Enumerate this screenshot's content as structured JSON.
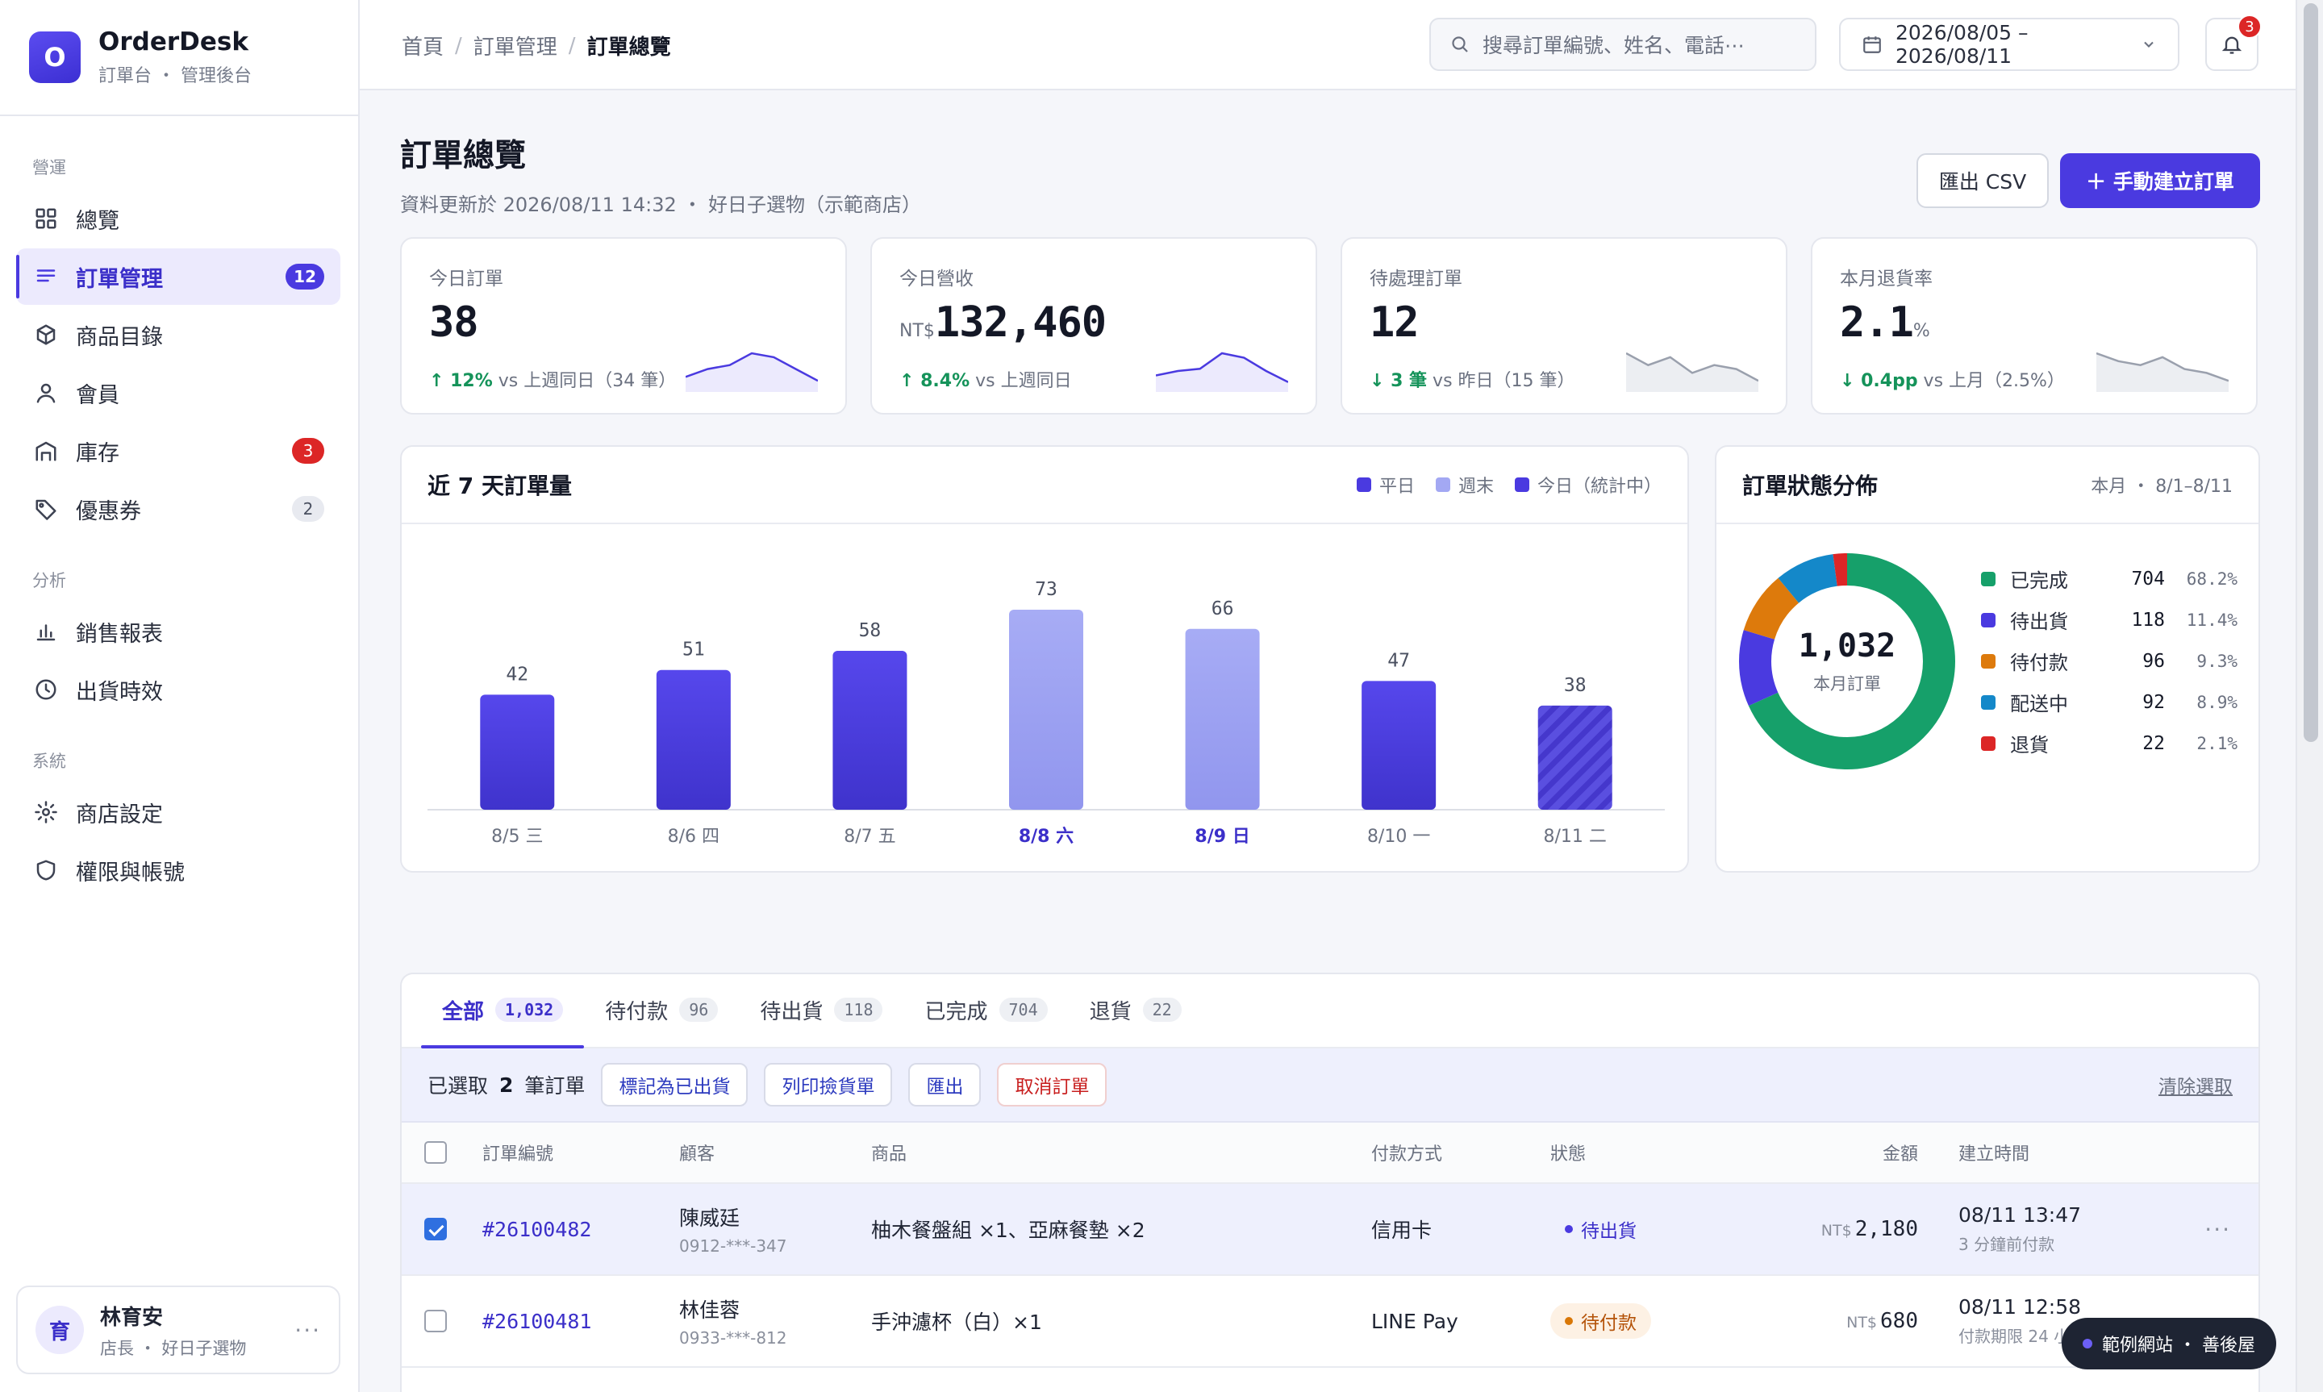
{
  "brand": {
    "name": "OrderDesk",
    "logo_letter": "O",
    "subtitle": "訂單台 ・ 管理後台"
  },
  "sidebar": {
    "sections": [
      {
        "label": "營運",
        "items": [
          {
            "label": "總覽",
            "icon": "grid-icon"
          },
          {
            "label": "訂單管理",
            "icon": "list-icon",
            "badge": "12",
            "active": true
          },
          {
            "label": "商品目錄",
            "icon": "box-icon"
          },
          {
            "label": "會員",
            "icon": "user-icon"
          },
          {
            "label": "庫存",
            "icon": "warehouse-icon",
            "badge": "3"
          },
          {
            "label": "優惠券",
            "icon": "tag-icon",
            "badge": "2"
          }
        ]
      },
      {
        "label": "分析",
        "items": [
          {
            "label": "銷售報表",
            "icon": "bar-chart-icon"
          },
          {
            "label": "出貨時效",
            "icon": "clock-icon"
          }
        ]
      },
      {
        "label": "系統",
        "items": [
          {
            "label": "商店設定",
            "icon": "gear-icon"
          },
          {
            "label": "權限與帳號",
            "icon": "shield-icon"
          }
        ]
      }
    ],
    "user": {
      "avatar": "育",
      "name": "林育安",
      "role": "店長 ・ 好日子選物",
      "more": "···"
    }
  },
  "topbar": {
    "breadcrumb": [
      "首頁",
      "訂單管理",
      "訂單總覽"
    ],
    "search_placeholder": "搜尋訂單編號、姓名、電話⋯",
    "date_range": "2026/08/05 – 2026/08/11",
    "notification_count": "3"
  },
  "page": {
    "title": "訂單總覽",
    "subtitle": "資料更新於 2026/08/11 14:32 ・ 好日子選物（示範商店）",
    "export_label": "匯出 CSV",
    "create_label": "＋ 手動建立訂單"
  },
  "kpis": [
    {
      "label": "今日訂單",
      "prefix": "",
      "value": "38",
      "suffix": "",
      "delta": "↑ 12%",
      "delta_note": " vs 上週同日（34 筆）",
      "trend": "up",
      "spark": [
        3,
        5,
        6,
        9,
        8,
        5,
        2
      ]
    },
    {
      "label": "今日營收",
      "prefix": "NT$",
      "value": "132,460",
      "suffix": "",
      "delta": "↑ 8.4%",
      "delta_note": " vs 上週同日",
      "trend": "up",
      "spark": [
        3,
        4,
        4.5,
        8,
        7,
        4,
        1.5
      ]
    },
    {
      "label": "待處理訂單",
      "prefix": "",
      "value": "12",
      "suffix": "",
      "delta": "↓ 3 筆",
      "delta_note": " vs 昨日（15 筆）",
      "trend": "down",
      "spark": [
        9,
        6,
        8,
        4,
        6,
        5,
        2
      ]
    },
    {
      "label": "本月退貨率",
      "prefix": "",
      "value": "2.1",
      "suffix": "%",
      "delta": "↓ 0.4pp",
      "delta_note": " vs 上月（2.5%）",
      "trend": "down",
      "spark": [
        9,
        7,
        6,
        8,
        5,
        4,
        2
      ]
    }
  ],
  "weekly_chart": {
    "title": "近 7 天訂單量",
    "legend": [
      {
        "label": "平日",
        "color": "#4a3ae0"
      },
      {
        "label": "週末",
        "color": "#a3a8f3"
      },
      {
        "label": "今日（統計中）",
        "color": "#4a3ae0"
      }
    ]
  },
  "chart_data": {
    "type": "bar",
    "categories": [
      "8/5 三",
      "8/6 四",
      "8/7 五",
      "8/8 六",
      "8/9 日",
      "8/10 一",
      "8/11 二"
    ],
    "values": [
      42,
      51,
      58,
      73,
      66,
      47,
      38
    ],
    "kinds": [
      "weekday",
      "weekday",
      "weekday",
      "weekend",
      "weekend",
      "weekday",
      "today"
    ],
    "ylim": [
      0,
      73
    ]
  },
  "status_chart": {
    "title": "訂單狀態分佈",
    "meta": "本月 ・ 8/1–8/11",
    "total": "1,032",
    "total_label": "本月訂單",
    "items": [
      {
        "name": "已完成",
        "count": "704",
        "pct": "68.2%",
        "value": 704,
        "color": "#16a06a"
      },
      {
        "name": "待出貨",
        "count": "118",
        "pct": "11.4%",
        "value": 118,
        "color": "#4a3ae0"
      },
      {
        "name": "待付款",
        "count": "96",
        "pct": "9.3%",
        "value": 96,
        "color": "#dd7a0c"
      },
      {
        "name": "配送中",
        "count": "92",
        "pct": "8.9%",
        "value": 92,
        "color": "#1488c9"
      },
      {
        "name": "退貨",
        "count": "22",
        "pct": "2.1%",
        "value": 22,
        "color": "#dc2626"
      }
    ]
  },
  "orders": {
    "tabs": [
      {
        "label": "全部",
        "count": "1,032",
        "active": true
      },
      {
        "label": "待付款",
        "count": "96"
      },
      {
        "label": "待出貨",
        "count": "118"
      },
      {
        "label": "已完成",
        "count": "704"
      },
      {
        "label": "退貨",
        "count": "22"
      }
    ],
    "bulk": {
      "selected_prefix": "已選取",
      "selected_count": "2",
      "selected_suffix": "筆訂單",
      "actions": [
        "標記為已出貨",
        "列印撿貨單",
        "匯出",
        "取消訂單"
      ],
      "clear": "清除選取"
    },
    "columns": [
      "訂單編號",
      "顧客",
      "商品",
      "付款方式",
      "狀態",
      "金額",
      "建立時間"
    ],
    "rows": [
      {
        "checked": true,
        "id": "#26100482",
        "customer": "陳威廷",
        "phone": "0912-***-347",
        "items": "柚木餐盤組 ×1、亞麻餐墊 ×2",
        "payment": "信用卡",
        "status": "待出貨",
        "status_kind": "ship",
        "currency": "NT$",
        "amount": "2,180",
        "time": "08/11 13:47",
        "time_note": "3 分鐘前付款"
      },
      {
        "checked": false,
        "id": "#26100481",
        "customer": "林佳蓉",
        "phone": "0933-***-812",
        "items": "手沖濾杯（白）×1",
        "payment": "LINE Pay",
        "status": "待付款",
        "status_kind": "pay",
        "currency": "NT$",
        "amount": "680",
        "time": "08/11 12:58",
        "time_note": "付款期限 24 小時"
      }
    ]
  },
  "watermark": "範例網站 ・ 善後屋"
}
